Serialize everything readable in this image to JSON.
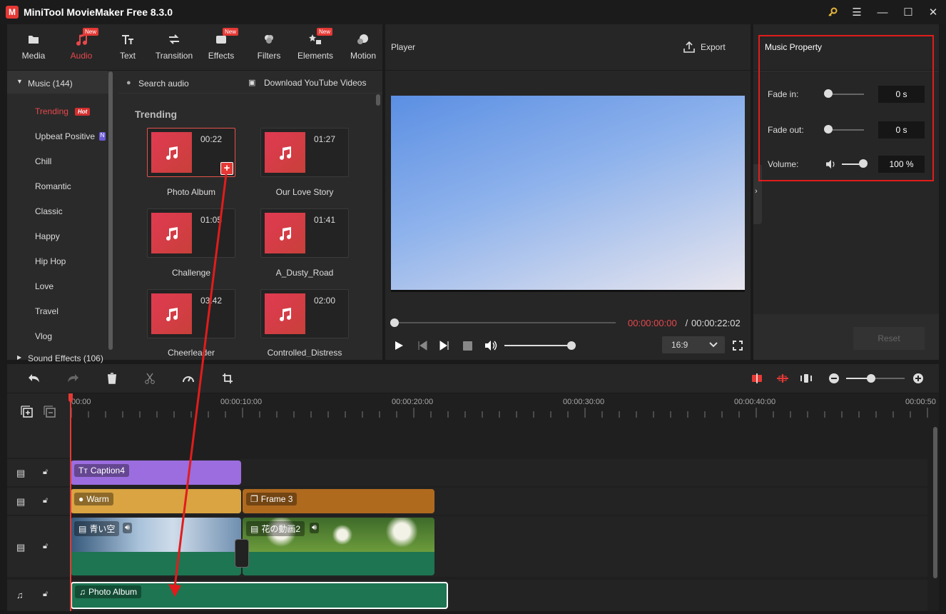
{
  "app": {
    "title": "MiniTool MovieMaker Free 8.3.0"
  },
  "toolbar": {
    "tabs": [
      {
        "label": "Media",
        "new": false
      },
      {
        "label": "Audio",
        "new": true,
        "active": true
      },
      {
        "label": "Text",
        "new": false
      },
      {
        "label": "Transition",
        "new": false
      },
      {
        "label": "Effects",
        "new": true
      },
      {
        "label": "Filters",
        "new": false
      },
      {
        "label": "Elements",
        "new": true
      },
      {
        "label": "Motion",
        "new": false
      }
    ],
    "new_badge": "New"
  },
  "library": {
    "music_header": "Music (144)",
    "categories": [
      "Trending",
      "Upbeat Positive",
      "Chill",
      "Romantic",
      "Classic",
      "Happy",
      "Hip Hop",
      "Love",
      "Travel",
      "Vlog"
    ],
    "hot_badge": "Hot",
    "sound_effects": "Sound Effects (106)",
    "search_placeholder": "Search audio",
    "download_label": "Download YouTube Videos",
    "section_title": "Trending",
    "tracks": [
      {
        "name": "Photo Album",
        "duration": "00:22"
      },
      {
        "name": "Our Love Story",
        "duration": "01:27"
      },
      {
        "name": "Challenge",
        "duration": "01:05"
      },
      {
        "name": "A_Dusty_Road",
        "duration": "01:41"
      },
      {
        "name": "Cheerleader",
        "duration": "03:42"
      },
      {
        "name": "Controlled_Distress",
        "duration": "02:00"
      }
    ]
  },
  "player": {
    "title": "Player",
    "export_label": "Export",
    "current_time": "00:00:00:00",
    "separator": " / ",
    "total_time": "00:00:22:02",
    "aspect_ratio": "16:9"
  },
  "properties": {
    "title": "Music Property",
    "fade_in_label": "Fade in:",
    "fade_in_value": "0 s",
    "fade_out_label": "Fade out:",
    "fade_out_value": "0 s",
    "volume_label": "Volume:",
    "volume_value": "100 %",
    "volume_level": 1.0,
    "reset_label": "Reset"
  },
  "timeline": {
    "ruler_labels": [
      "00:00",
      "00:00:10:00",
      "00:00:20:00",
      "00:00:30:00",
      "00:00:40:00",
      "00:00:50"
    ],
    "clips": {
      "caption": "Caption4",
      "filter": "Warm",
      "frame": "Frame 3",
      "video1": "青い空",
      "video2": "花の動画2",
      "audio": "Photo Album"
    }
  },
  "colors": {
    "accent": "#e8474c",
    "caption_clip": "#9b6ddf",
    "filter_clip": "#d9a441",
    "frame_clip": "#b06a1e",
    "video_audio": "#1d7552",
    "highlight": "#e21c1c"
  }
}
